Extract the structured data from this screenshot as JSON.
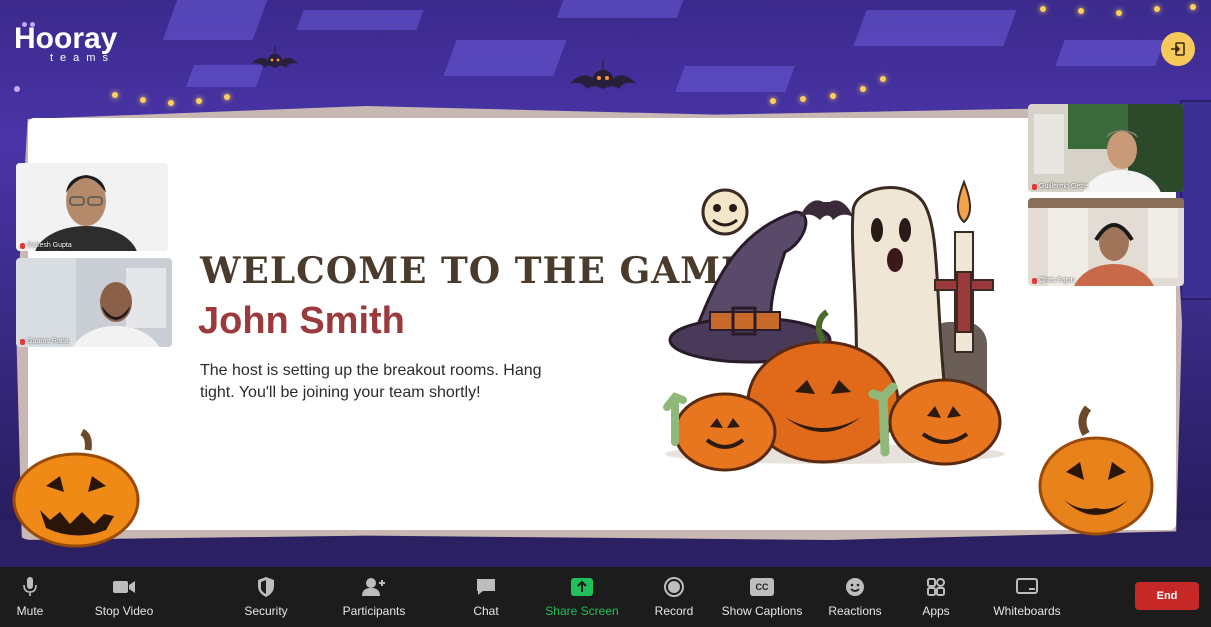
{
  "brand": {
    "name": "Hooray",
    "sub": "teams"
  },
  "header": {
    "exit_icon": "exit-door-icon"
  },
  "card": {
    "welcome": "WELCOME TO THE GAME",
    "player_name": "John Smith",
    "message": "The host is setting up the breakout rooms. Hang tight. You'll be joining your team shortly!"
  },
  "participants": [
    {
      "name": "Rakesh Gupta"
    },
    {
      "name": "Gaurav Rana"
    },
    {
      "name": "Guillermo Gette"
    },
    {
      "name": "Chris Fajou"
    }
  ],
  "toolbar": {
    "items": [
      {
        "label": "Mute",
        "icon": "microphone-icon"
      },
      {
        "label": "Stop Video",
        "icon": "video-camera-icon"
      },
      {
        "label": "Security",
        "icon": "shield-icon"
      },
      {
        "label": "Participants",
        "icon": "participants-icon"
      },
      {
        "label": "Chat",
        "icon": "chat-bubble-icon"
      },
      {
        "label": "Share Screen",
        "icon": "share-screen-icon"
      },
      {
        "label": "Record",
        "icon": "record-icon"
      },
      {
        "label": "Show Captions",
        "icon": "captions-icon"
      },
      {
        "label": "Reactions",
        "icon": "smiley-icon"
      },
      {
        "label": "Apps",
        "icon": "apps-icon"
      },
      {
        "label": "Whiteboards",
        "icon": "whiteboard-icon"
      }
    ],
    "end_label": "End",
    "captions_glyph": "CC"
  },
  "colors": {
    "accent_green": "#20c05a",
    "end_red": "#c62828",
    "title_brown": "#4a3b2c",
    "name_red": "#9a3a3c",
    "exit_yellow": "#f7c85a"
  }
}
